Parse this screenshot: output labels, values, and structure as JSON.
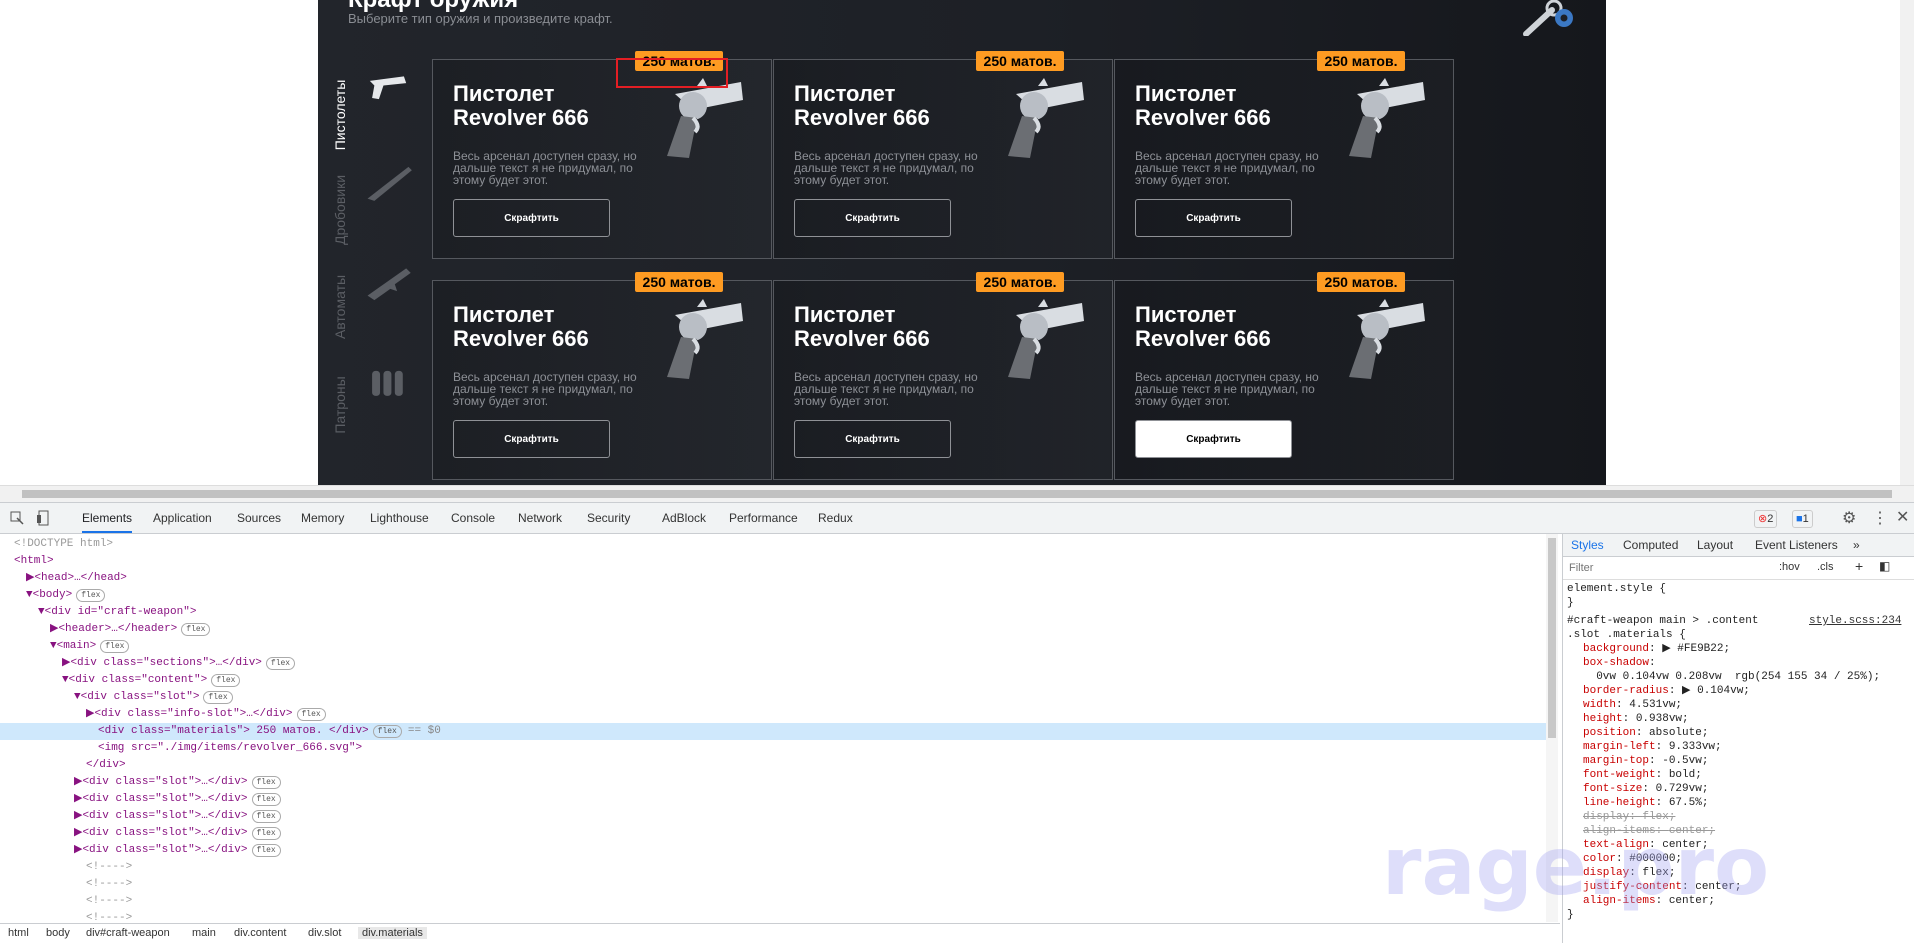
{
  "app": {
    "title": "Крафт оружия",
    "subtitle": "Выберите тип оружия и произведите крафт.",
    "sections": [
      {
        "label": "Пистолеты",
        "active": true
      },
      {
        "label": "Дробовики",
        "active": false
      },
      {
        "label": "Автоматы",
        "active": false
      },
      {
        "label": "Патроны",
        "active": false
      }
    ],
    "slots": [
      {
        "title": "Пистолет Revolver 666",
        "desc": "Весь арсенал доступен сразу, но дальше текст я не придумал, по этому будет этот.",
        "materials": "250 матов.",
        "button": "Скрафтить"
      },
      {
        "title": "Пистолет Revolver 666",
        "desc": "Весь арсенал доступен сразу, но дальше текст я не придумал, по этому будет этот.",
        "materials": "250 матов.",
        "button": "Скрафтить"
      },
      {
        "title": "Пистолет Revolver 666",
        "desc": "Весь арсенал доступен сразу, но дальше текст я не придумал, по этому будет этот.",
        "materials": "250 матов.",
        "button": "Скрафтить"
      },
      {
        "title": "Пистолет Revolver 666",
        "desc": "Весь арсенал доступен сразу, но дальше текст я не придумал, по этому будет этот.",
        "materials": "250 матов.",
        "button": "Скрафтить"
      },
      {
        "title": "Пистолет Revolver 666",
        "desc": "Весь арсенал доступен сразу, но дальше текст я не придумал, по этому будет этот.",
        "materials": "250 матов.",
        "button": "Скрафтить"
      },
      {
        "title": "Пистолет Revolver 666",
        "desc": "Весь арсенал доступен сразу, но дальше текст я не придумал, по этому будет этот.",
        "materials": "250 матов.",
        "button": "Скрафтить"
      }
    ],
    "colors": {
      "materials_bg": "#FE9B22",
      "selection": "#e31e24"
    }
  },
  "devtools": {
    "tabs": [
      "Elements",
      "Application",
      "Sources",
      "Memory",
      "Lighthouse",
      "Console",
      "Network",
      "Security",
      "AdBlock",
      "Performance",
      "Redux"
    ],
    "active_tab": "Elements",
    "error_count": "2",
    "message_count": "1",
    "dom_lines": [
      {
        "text": "<!DOCTYPE html>",
        "indent": 0
      },
      {
        "text": "<html>",
        "indent": 0
      },
      {
        "text": "▶<head>…</head>",
        "indent": 1
      },
      {
        "text": "▼<body>",
        "indent": 1,
        "badge": "flex"
      },
      {
        "text": "▼<div id=\"craft-weapon\">",
        "indent": 2
      },
      {
        "text": "▶<header>…</header>",
        "indent": 3,
        "badge": "flex"
      },
      {
        "text": "▼<main>",
        "indent": 3,
        "badge": "flex"
      },
      {
        "text": "▶<div class=\"sections\">…</div>",
        "indent": 4,
        "badge": "flex"
      },
      {
        "text": "▼<div class=\"content\">",
        "indent": 4,
        "badge": "flex"
      },
      {
        "text": "▼<div class=\"slot\">",
        "indent": 5,
        "badge": "flex"
      },
      {
        "text": "▶<div class=\"info-slot\">…</div>",
        "indent": 6,
        "badge": "flex"
      },
      {
        "text": "<div class=\"materials\"> 250 матов. </div>",
        "indent": 7,
        "badge": "flex",
        "suffix": "== $0",
        "selected": true
      },
      {
        "text": "<img src=\"./img/items/revolver_666.svg\">",
        "indent": 7
      },
      {
        "text": "</div>",
        "indent": 6
      },
      {
        "text": "▶<div class=\"slot\">…</div>",
        "indent": 5,
        "badge": "flex"
      },
      {
        "text": "▶<div class=\"slot\">…</div>",
        "indent": 5,
        "badge": "flex"
      },
      {
        "text": "▶<div class=\"slot\">…</div>",
        "indent": 5,
        "badge": "flex"
      },
      {
        "text": "▶<div class=\"slot\">…</div>",
        "indent": 5,
        "badge": "flex"
      },
      {
        "text": "▶<div class=\"slot\">…</div>",
        "indent": 5,
        "badge": "flex"
      },
      {
        "text": "<!---->",
        "indent": 6
      },
      {
        "text": "<!---->",
        "indent": 6
      },
      {
        "text": "<!---->",
        "indent": 6
      },
      {
        "text": "<!---->",
        "indent": 6
      }
    ],
    "breadcrumbs": [
      "html",
      "body",
      "div#craft-weapon",
      "main",
      "div.content",
      "div.slot",
      "div.materials"
    ],
    "styles": {
      "tabs": [
        "Styles",
        "Computed",
        "Layout",
        "Event Listeners",
        "»"
      ],
      "active_tab": "Styles",
      "filter_placeholder": "Filter",
      "hov": ":hov",
      "cls": ".cls",
      "element_style": "element.style {",
      "element_style_close": "}",
      "selector_line1": "#craft-weapon main > .content",
      "selector_line2": ".slot .materials {",
      "source": "style.scss:234",
      "rules": [
        {
          "prop": "background",
          "value": "▶ #FE9B22;"
        },
        {
          "prop": "box-shadow",
          "value": ""
        },
        {
          "prop": "",
          "value": "  0vw 0.104vw 0.208vw  rgb(254 155 34 / 25%);"
        },
        {
          "prop": "border-radius",
          "value": "▶ 0.104vw;"
        },
        {
          "prop": "width",
          "value": "4.531vw;"
        },
        {
          "prop": "height",
          "value": "0.938vw;"
        },
        {
          "prop": "position",
          "value": "absolute;"
        },
        {
          "prop": "margin-left",
          "value": "9.333vw;"
        },
        {
          "prop": "margin-top",
          "value": "-0.5vw;"
        },
        {
          "prop": "font-weight",
          "value": "bold;"
        },
        {
          "prop": "font-size",
          "value": "0.729vw;"
        },
        {
          "prop": "line-height",
          "value": "67.5%;"
        },
        {
          "prop": "display",
          "value": "flex;",
          "struck": true
        },
        {
          "prop": "align-items",
          "value": "center;",
          "struck": true
        },
        {
          "prop": "text-align",
          "value": "center;"
        },
        {
          "prop": "color",
          "value": "#000000;"
        },
        {
          "prop": "display",
          "value": "flex;"
        },
        {
          "prop": "justify-content",
          "value": "center;"
        },
        {
          "prop": "align-items",
          "value": "center;"
        }
      ],
      "close": "}"
    }
  },
  "watermark": "rage.pro"
}
